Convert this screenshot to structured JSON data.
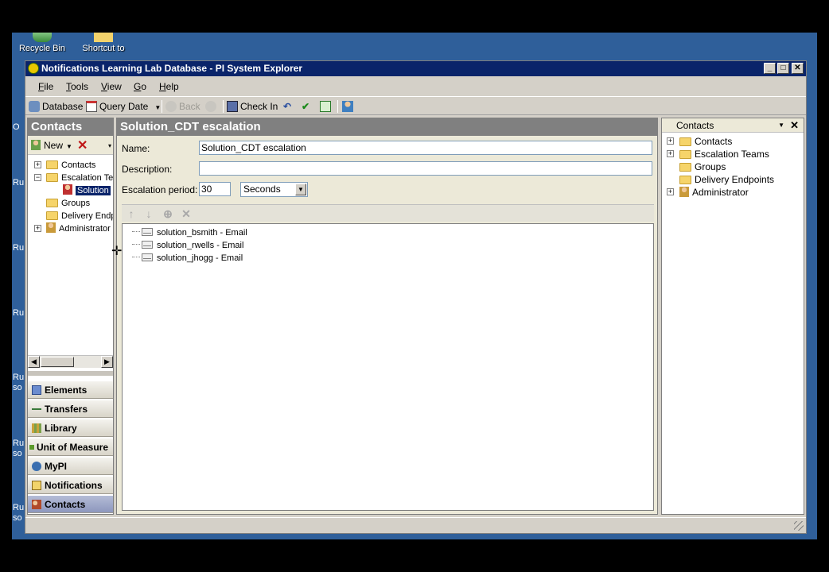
{
  "desktop": {
    "icons": [
      {
        "label": "Recycle Bin"
      },
      {
        "label": "Shortcut to"
      }
    ],
    "side_labels": [
      "O",
      "Ru",
      "Ru",
      "Ru",
      "Ru",
      "so",
      "Ru",
      "so",
      "Ru",
      "so"
    ]
  },
  "window": {
    "title": "Notifications Learning Lab Database - PI System Explorer",
    "controls": {
      "minimize": "_",
      "maximize": "□",
      "close": "✕"
    }
  },
  "menu": {
    "items": [
      {
        "accel": "F",
        "rest": "ile"
      },
      {
        "accel": "T",
        "rest": "ools"
      },
      {
        "accel": "V",
        "rest": "iew"
      },
      {
        "accel": "G",
        "rest": "o"
      },
      {
        "accel": "H",
        "rest": "elp"
      }
    ]
  },
  "toolbar": {
    "database": "Database",
    "query_date": "Query Date",
    "back": "Back",
    "check_in": "Check In"
  },
  "left_pane": {
    "title": "Contacts",
    "new_label": "New",
    "tree": [
      {
        "label": "Contacts",
        "expander": "+"
      },
      {
        "label": "Escalation Te",
        "expander": "−"
      },
      {
        "label": "Solution",
        "selected": true
      },
      {
        "label": "Groups"
      },
      {
        "label": "Delivery Endp"
      },
      {
        "label": "Administrator",
        "expander": "+"
      }
    ],
    "nav": [
      {
        "label": "Elements"
      },
      {
        "label": "Transfers"
      },
      {
        "label": "Library"
      },
      {
        "label": "Unit of Measure"
      },
      {
        "label": "MyPI"
      },
      {
        "label": "Notifications"
      },
      {
        "label": "Contacts",
        "active": true
      }
    ]
  },
  "main_pane": {
    "title": "Solution_CDT escalation",
    "name_label": "Name:",
    "name_value": "Solution_CDT escalation",
    "description_label": "Description:",
    "description_value": "",
    "escalation_label": "Escalation period:",
    "escalation_value": "30",
    "escalation_unit": "Seconds",
    "members": [
      "solution_bsmith - Email",
      "solution_rwells - Email",
      "solution_jhogg - Email"
    ]
  },
  "right_pane": {
    "title": "Contacts",
    "tree": [
      {
        "label": "Contacts",
        "expander": "+"
      },
      {
        "label": "Escalation Teams",
        "expander": "+"
      },
      {
        "label": "Groups"
      },
      {
        "label": "Delivery Endpoints"
      },
      {
        "label": "Administrator",
        "expander": "+"
      }
    ]
  },
  "colors": {
    "titlebar": "#0a246a",
    "pane_header": "#808080",
    "selection": "#0a246a",
    "desktop": "#2f5f9a"
  }
}
